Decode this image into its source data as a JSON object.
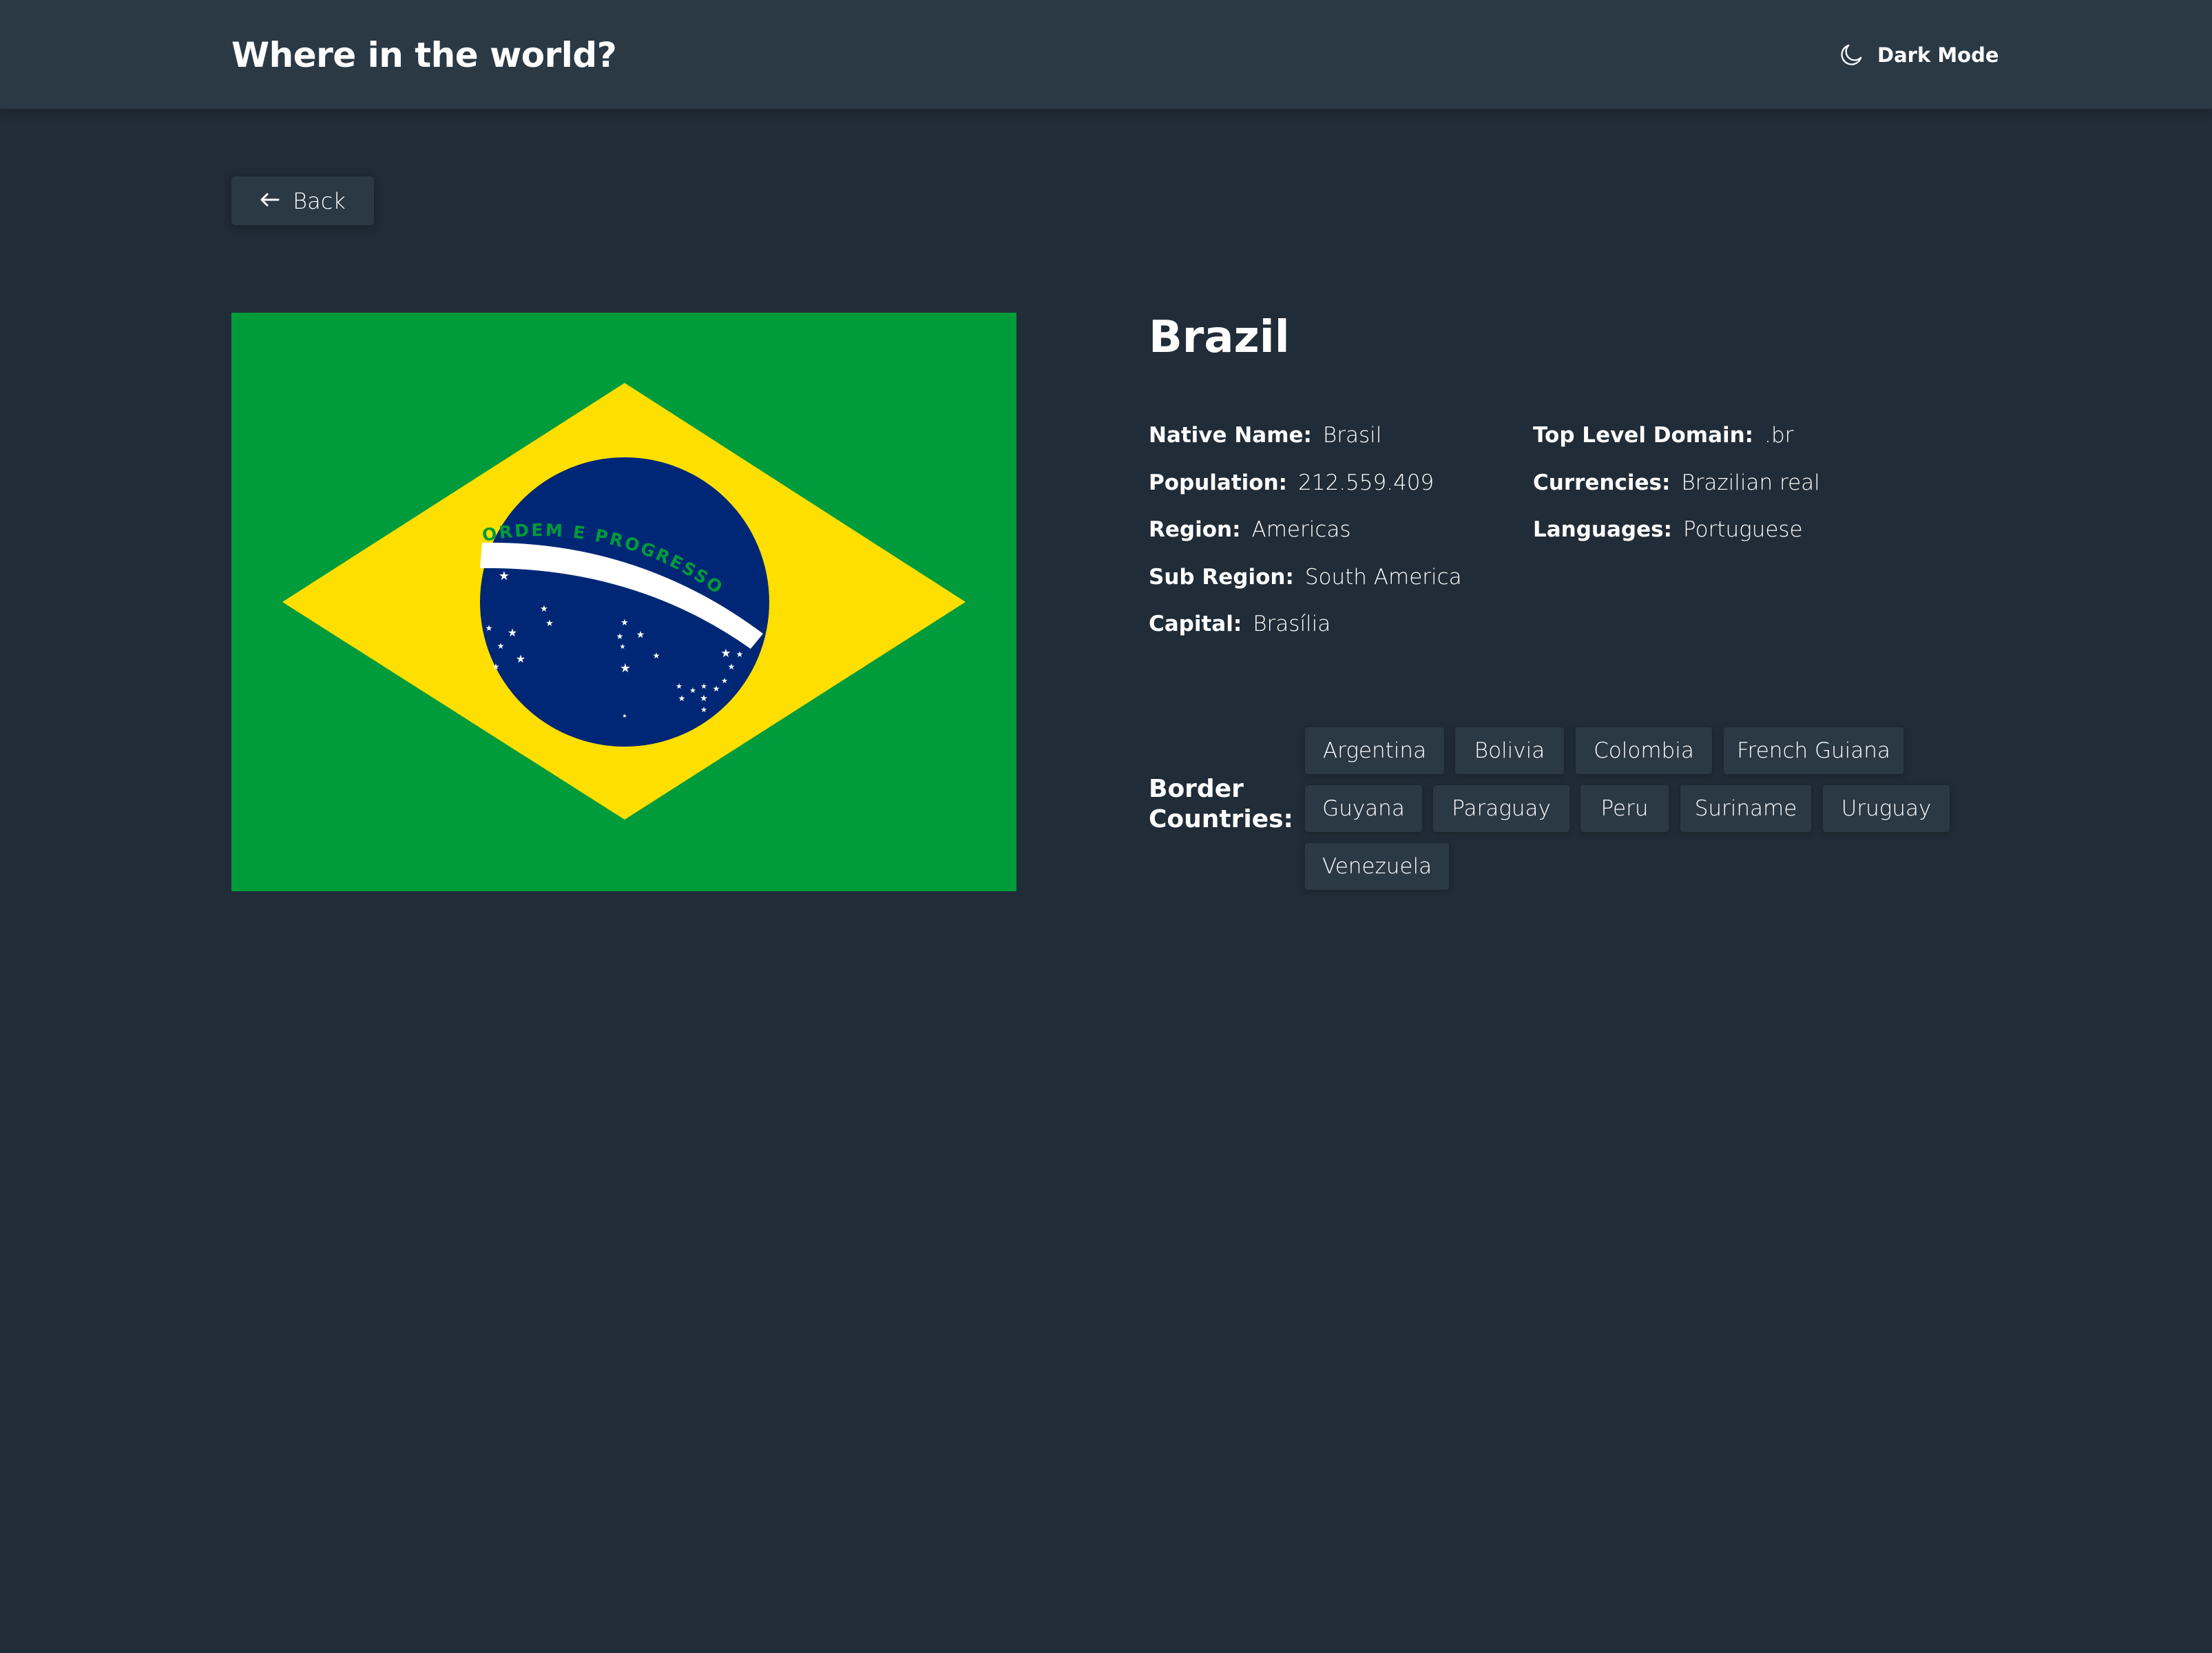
{
  "header": {
    "title": "Where in the world?",
    "theme_toggle_label": "Dark Mode",
    "theme_icon": "moon-icon"
  },
  "back_button": {
    "label": "Back",
    "icon": "arrow-left-icon"
  },
  "country": {
    "name": "Brazil",
    "flag_motto": "ORDEM E PROGRESSO",
    "flag_colors": {
      "green": "#009b3a",
      "yellow": "#fedf00",
      "blue": "#002776",
      "white": "#ffffff"
    },
    "details_left": [
      {
        "label": "Native Name:",
        "value": "Brasil"
      },
      {
        "label": "Population:",
        "value": "212.559.409"
      },
      {
        "label": "Region:",
        "value": "Americas"
      },
      {
        "label": "Sub Region:",
        "value": "South America"
      },
      {
        "label": "Capital:",
        "value": "Brasília"
      }
    ],
    "details_right": [
      {
        "label": "Top Level Domain:",
        "value": ".br"
      },
      {
        "label": "Currencies:",
        "value": "Brazilian real"
      },
      {
        "label": "Languages:",
        "value": "Portuguese"
      }
    ],
    "border_label": "Border Countries:",
    "border_countries": [
      "Argentina",
      "Bolivia",
      "Colombia",
      "French Guiana",
      "Guyana",
      "Paraguay",
      "Peru",
      "Suriname",
      "Uruguay",
      "Venezuela"
    ]
  },
  "colors": {
    "background": "#202c37",
    "element": "#2b3945",
    "text": "#ffffff"
  }
}
